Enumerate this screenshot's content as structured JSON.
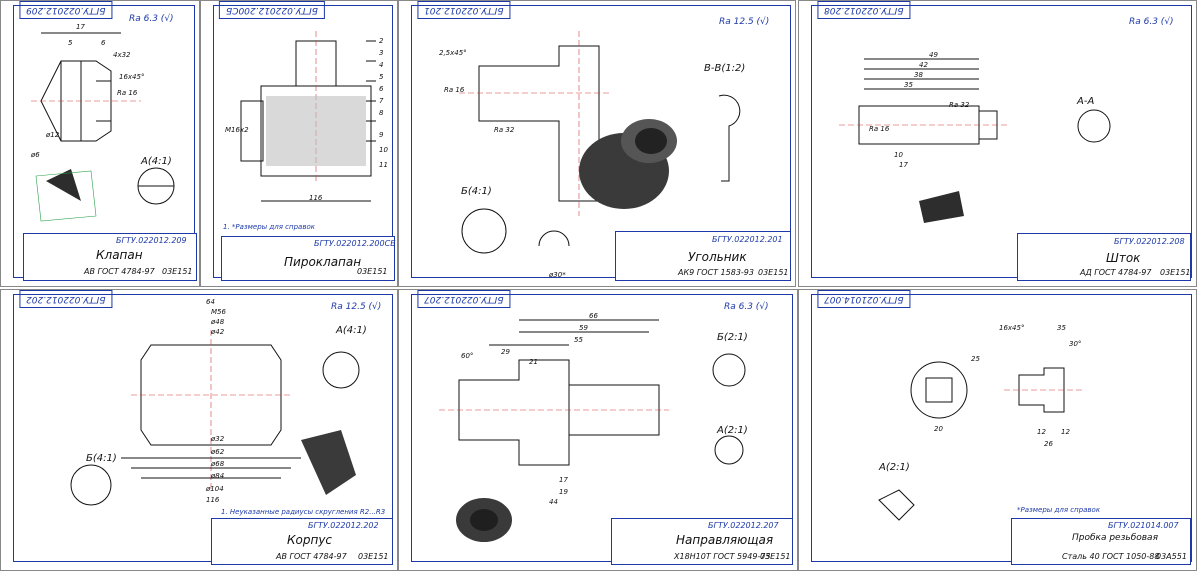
{
  "sheets": [
    {
      "code": "БГТУ.022012.209",
      "roughness": "Ra 6.3 (√)",
      "name": "Клапан",
      "material": "АВ ГОСТ 4784-97",
      "group": "03Е151",
      "section": "А(4:1)",
      "dims": [
        "17",
        "5",
        "6",
        "4x32",
        "16x45°",
        "Ra 16",
        "ø12",
        "ø6"
      ]
    },
    {
      "code": "БГТУ.022012.200СБ",
      "roughness": "",
      "name": "Пироклапан",
      "material": "",
      "group": "03Е151",
      "note": "1. *Размеры для справок",
      "dims": [
        "116",
        "M16x2",
        "2",
        "3",
        "4",
        "5",
        "6",
        "7",
        "8",
        "9",
        "10",
        "11"
      ]
    },
    {
      "code": "БГТУ.022012.201",
      "roughness": "Ra 12.5 (√)",
      "name": "Угольник",
      "material": "АК9 ГОСТ 1583-93",
      "group": "03Е151",
      "section": "Б(4:1)",
      "section2": "В-В(1:2)",
      "dims": [
        "Ra 16",
        "Ra 32",
        "ø30*",
        "2,5x45°"
      ]
    },
    {
      "code": "БГТУ.022012.208",
      "roughness": "Ra 6.3 (√)",
      "name": "Шток",
      "material": "АД ГОСТ 4784-97",
      "group": "03Е151",
      "section": "А-А",
      "dims": [
        "49",
        "42",
        "38",
        "35",
        "Ra 16",
        "Ra 32",
        "17",
        "10"
      ]
    },
    {
      "code": "БГТУ.022012.202",
      "roughness": "Ra 12.5 (√)",
      "name": "Корпус",
      "material": "АВ ГОСТ 4784-97",
      "group": "03Е151",
      "section": "А(4:1)",
      "section2": "Б(4:1)",
      "note": "1. Неуказанные радиусы скругления R2...R3",
      "dims": [
        "64",
        "M56",
        "ø48",
        "ø42",
        "ø32",
        "ø62",
        "ø68",
        "ø84",
        "ø104",
        "116"
      ]
    },
    {
      "code": "БГТУ.022012.207",
      "roughness": "Ra 6.3 (√)",
      "name": "Направляющая",
      "material": "Х18Н10Т ГОСТ 5949-75",
      "group": "03Е151",
      "section": "Б(2:1)",
      "section2": "А(2:1)",
      "dims": [
        "66",
        "59",
        "55",
        "29",
        "21",
        "60°",
        "17",
        "19",
        "44"
      ]
    },
    {
      "code": "БГТУ.021014.007",
      "roughness": "",
      "name": "Пробка резьбовая",
      "material": "Сталь 40 ГОСТ 1050-88",
      "group": "03А551",
      "section": "А(2:1)",
      "note": "*Размеры для справок",
      "dims": [
        "16x45°",
        "35",
        "30°",
        "25",
        "20",
        "12",
        "26",
        "12"
      ]
    }
  ],
  "colors": {
    "frame": "#1e3aa8",
    "line": "#111111",
    "part": "#2a2a2a",
    "accent": "#d23a3a"
  }
}
